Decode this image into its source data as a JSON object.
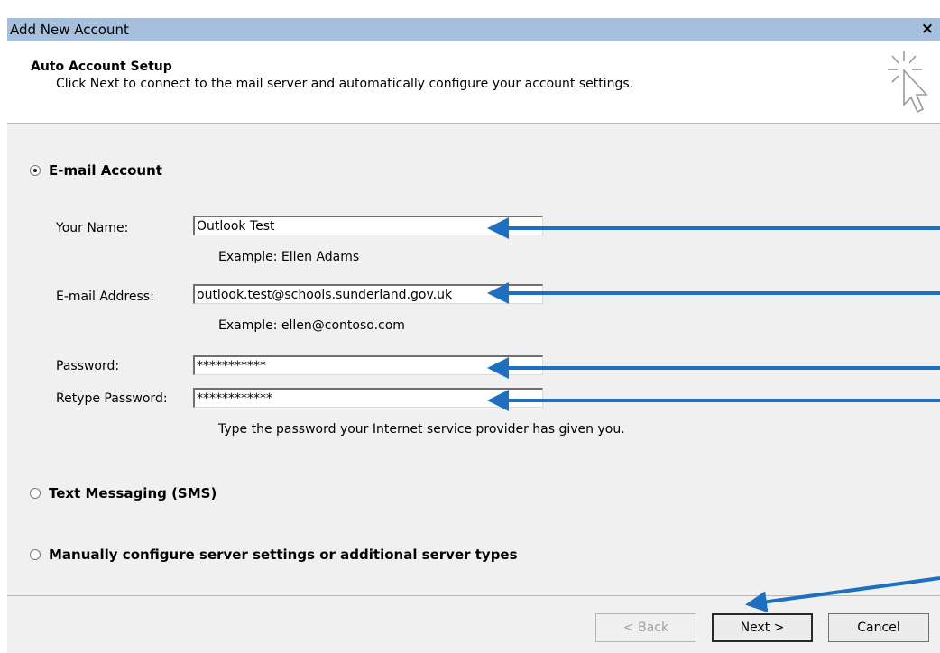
{
  "window": {
    "title": "Add New Account",
    "close_label": "×"
  },
  "header": {
    "title": "Auto Account Setup",
    "description": "Click Next to connect to the mail server and automatically configure your account settings."
  },
  "options": {
    "email_account": {
      "label": "E-mail Account",
      "selected": true
    },
    "sms": {
      "label": "Text Messaging (SMS)",
      "selected": false
    },
    "manual": {
      "label": "Manually configure server settings or additional server types",
      "selected": false
    }
  },
  "form": {
    "name": {
      "label": "Your Name:",
      "value": "Outlook Test",
      "example": "Example: Ellen Adams"
    },
    "email": {
      "label": "E-mail Address:",
      "value": "outlook.test@schools.sunderland.gov.uk",
      "example": "Example: ellen@contoso.com"
    },
    "password": {
      "label": "Password:",
      "value": "***********"
    },
    "retype_password": {
      "label": "Retype Password:",
      "value": "************"
    },
    "password_hint": "Type the password your Internet service provider has given you."
  },
  "buttons": {
    "back": "< Back",
    "next": "Next >",
    "cancel": "Cancel"
  },
  "colors": {
    "titlebar": "#a6bfdc",
    "annotation_arrow": "#1f6fc0"
  }
}
